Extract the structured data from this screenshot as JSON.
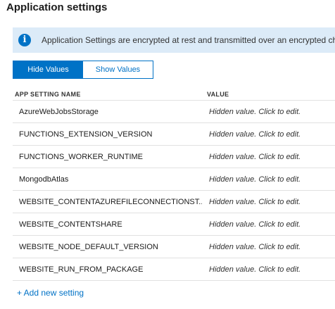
{
  "page": {
    "title": "Application settings"
  },
  "info_banner": {
    "icon": "info-icon",
    "icon_glyph": "i",
    "text": "Application Settings are encrypted at rest and transmitted over an encrypted ch"
  },
  "toggle": {
    "hide_label": "Hide Values",
    "show_label": "Show Values",
    "selected": "Hide Values"
  },
  "table": {
    "headers": {
      "name": "APP SETTING NAME",
      "value": "VALUE"
    },
    "rows": [
      {
        "name": "AzureWebJobsStorage",
        "value": "Hidden value. Click to edit."
      },
      {
        "name": "FUNCTIONS_EXTENSION_VERSION",
        "value": "Hidden value. Click to edit."
      },
      {
        "name": "FUNCTIONS_WORKER_RUNTIME",
        "value": "Hidden value. Click to edit."
      },
      {
        "name": "MongodbAtlas",
        "value": "Hidden value. Click to edit."
      },
      {
        "name": "WEBSITE_CONTENTAZUREFILECONNECTIONST...",
        "value": "Hidden value. Click to edit."
      },
      {
        "name": "WEBSITE_CONTENTSHARE",
        "value": "Hidden value. Click to edit."
      },
      {
        "name": "WEBSITE_NODE_DEFAULT_VERSION",
        "value": "Hidden value. Click to edit."
      },
      {
        "name": "WEBSITE_RUN_FROM_PACKAGE",
        "value": "Hidden value. Click to edit."
      }
    ]
  },
  "add_setting": {
    "label": "+ Add new setting"
  },
  "colors": {
    "accent": "#0072c6",
    "banner_bg": "#dcebf8",
    "divider": "#e1e1e1"
  }
}
